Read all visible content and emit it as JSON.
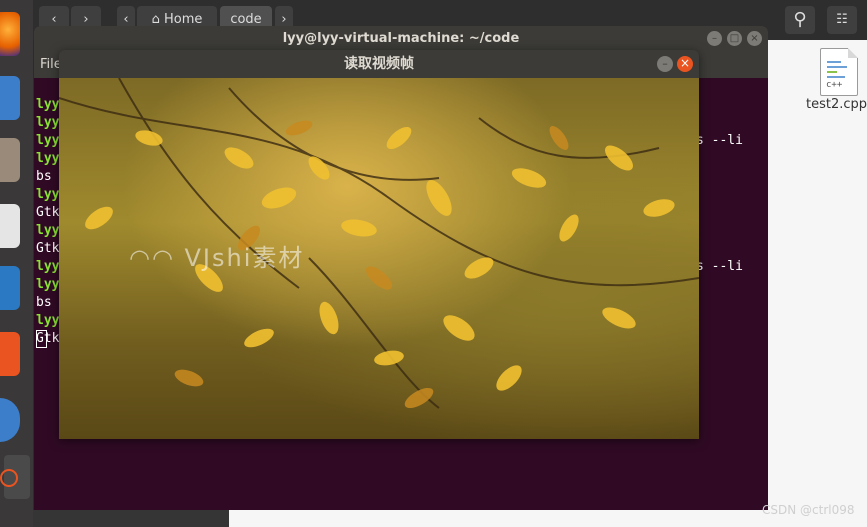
{
  "files_window": {
    "nav_back": "‹",
    "nav_forward": "›",
    "crumb_left": "‹",
    "home_label": "Home",
    "code_label": "code",
    "crumb_right": "›",
    "search_icon": "⚲",
    "view_icon": "☷",
    "file_name": "test2.cpp",
    "file_icon_text": "c++"
  },
  "terminal": {
    "title": "lyy@lyy-virtual-machine: ~/code",
    "menu_first": "File",
    "lines": [
      {
        "text": "lyy",
        "style": "green"
      },
      {
        "text": "lyy",
        "style": "green"
      },
      {
        "text": "lyy",
        "style": "green"
      },
      {
        "text": "lyy",
        "style": "green"
      },
      {
        "text": "bs",
        "style": "white"
      },
      {
        "text": "lyy",
        "style": "green"
      },
      {
        "text": "Gtk",
        "style": "white"
      },
      {
        "text": "lyy",
        "style": "green"
      },
      {
        "text": "Gtk",
        "style": "white"
      },
      {
        "text": "lyy",
        "style": "green"
      },
      {
        "text": "lyy",
        "style": "green"
      },
      {
        "text": "bs",
        "style": "white"
      },
      {
        "text": "lyy",
        "style": "green"
      },
      {
        "text": "Gtk",
        "style": "white"
      }
    ],
    "right_text_1": "s --li",
    "right_text_2": "s --li"
  },
  "video_window": {
    "title": "读取视频帧",
    "minimize": "–",
    "close": "×",
    "watermark": "VJshi素材"
  },
  "credit": "CSDN @ctrl098",
  "colors": {
    "terminal_bg": "#300a24",
    "prompt_green": "#8ae234",
    "close_orange": "#e95420"
  }
}
